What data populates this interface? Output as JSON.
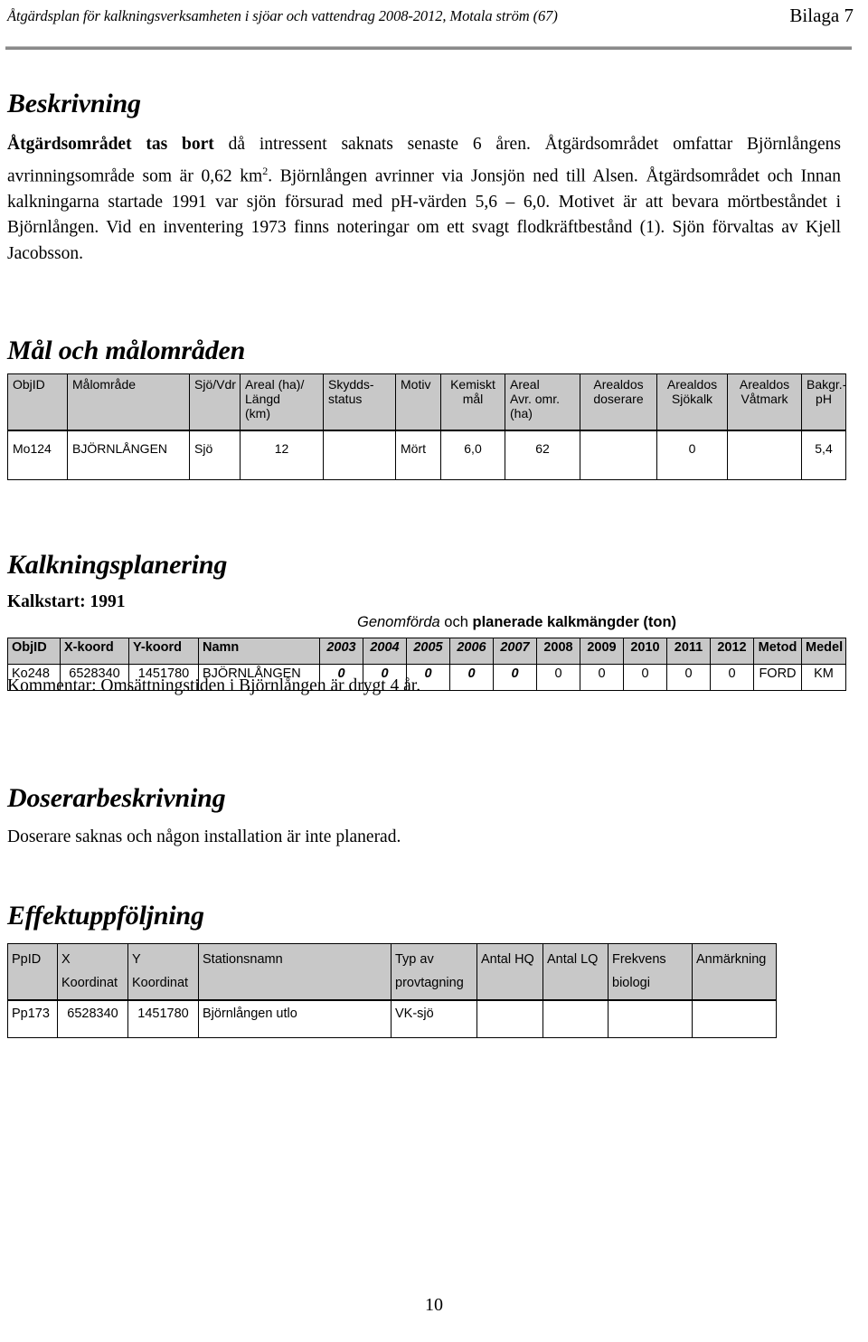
{
  "header": {
    "left_text": "Åtgärdsplan för kalkningsverksamheten i sjöar och vattendrag 2008-2012, Motala ström (67)",
    "right_text": "Bilaga 7"
  },
  "sections": {
    "beskrivning": {
      "title": "Beskrivning",
      "lead_bold": "Åtgärdsområdet tas bort",
      "body_part1": " då intressent saknats senaste 6 åren. Åtgärdsområdet omfattar Björnlångens avrinningsområde som är 0,62 km",
      "sup": "2",
      "body_part2": ". Björnlången avrinner via Jonsjön ned till Alsen. Åtgärdsområdet och Innan kalkningarna startade 1991 var sjön försurad med pH-värden 5,6 – 6,0. Motivet är att bevara mörtbeståndet i Björnlången. Vid en inventering 1973 finns noteringar om ett svagt flodkräftbestånd (1). Sjön förvaltas av Kjell Jacobsson."
    },
    "mal": {
      "title": "Mål och målområden"
    },
    "kalkning": {
      "title": "Kalkningsplanering",
      "kalkstart": "Kalkstart: 1991",
      "caption_italic": "Genomförda",
      "caption_plain": " och ",
      "caption_bold": "planerade kalkmängder (ton)",
      "kommentar": "Kommentar: Omsättningstiden i Björnlången är drygt 4 år."
    },
    "doserare": {
      "title": "Doserarbeskrivning",
      "body": "Doserare saknas och någon installation är inte planerad."
    },
    "effekt": {
      "title": "Effektuppföljning"
    }
  },
  "mal_table": {
    "headers": [
      "ObjID",
      "Målområde",
      "Sjö/Vdr",
      "Areal (ha)/ Längd (km)",
      "Skydds- status",
      "Motiv",
      "Kemiskt mål",
      "Areal Avr. omr. (ha)",
      "Arealdos doserare",
      "Arealdos Sjökalk",
      "Arealdos Våtmark",
      "Bakgr.- pH"
    ],
    "headers_lines": [
      [
        "ObjID"
      ],
      [
        "Målområde"
      ],
      [
        "Sjö/Vdr"
      ],
      [
        "Areal (ha)/",
        "Längd",
        "(km)"
      ],
      [
        "Skydds-",
        "status"
      ],
      [
        "Motiv"
      ],
      [
        "Kemiskt",
        "mål"
      ],
      [
        "Areal",
        "Avr. omr.",
        "(ha)"
      ],
      [
        "Arealdos",
        "doserare"
      ],
      [
        "Arealdos",
        "Sjökalk"
      ],
      [
        "Arealdos",
        "Våtmark"
      ],
      [
        "Bakgr.-",
        "pH"
      ]
    ],
    "rows": [
      {
        "objid": "Mo124",
        "malomrade": "BJÖRNLÅNGEN",
        "sjo_vdr": "Sjö",
        "areal_langd": "12",
        "skyddsstatus": "",
        "motiv": "Mört",
        "kemiskt_mal": "6,0",
        "areal_avr": "62",
        "arealdos_doserare": "",
        "arealdos_sjokalk": "0",
        "arealdos_vatmark": "",
        "bakgr_ph": "5,4"
      }
    ]
  },
  "kalk_table": {
    "headers": [
      "ObjID",
      "X-koord",
      "Y-koord",
      "Namn",
      "2003",
      "2004",
      "2005",
      "2006",
      "2007",
      "2008",
      "2009",
      "2010",
      "2011",
      "2012",
      "Metod",
      "Medel"
    ],
    "rows": [
      {
        "objid": "Ko248",
        "x_koord": "6528340",
        "y_koord": "1451780",
        "namn": "BJÖRNLÅNGEN",
        "y2003": "0",
        "y2004": "0",
        "y2005": "0",
        "y2006": "0",
        "y2007": "0",
        "y2008": "0",
        "y2009": "0",
        "y2010": "0",
        "y2011": "0",
        "y2012": "0",
        "metod": "FORD",
        "medel": "KM"
      }
    ]
  },
  "eff_table": {
    "headers_lines": [
      [
        "PpID"
      ],
      [
        "X Koordinat"
      ],
      [
        "Y Koordinat"
      ],
      [
        "Stationsnamn"
      ],
      [
        "Typ av",
        "provtagning"
      ],
      [
        "Antal HQ"
      ],
      [
        "Antal LQ"
      ],
      [
        "Frekvens",
        "biologi"
      ],
      [
        "Anmärkning"
      ]
    ],
    "rows": [
      {
        "ppid": "Pp173",
        "x_koordinat": "6528340",
        "y_koordinat": "1451780",
        "stationsnamn": "Björnlången  utlo",
        "typ_av_provtagning": "VK-sjö",
        "antal_hq": "",
        "antal_lq": "",
        "frekvens_biologi": "",
        "anmarkning": ""
      }
    ]
  },
  "page": {
    "number": "10"
  },
  "colors": {
    "table_header_bg": "#c8c8c8",
    "rule": "#8a8a8a",
    "text": "#000000"
  }
}
